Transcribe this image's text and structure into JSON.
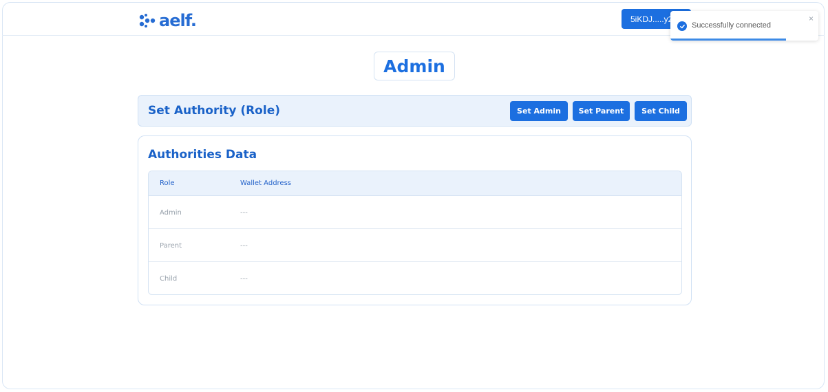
{
  "header": {
    "logo_text": "aelf.",
    "wallet_label": "5iKDJ.....y2"
  },
  "toast": {
    "message": "Successfully connected",
    "close_glyph": "×",
    "progress": 0.78
  },
  "main": {
    "title": "Admin",
    "authority": {
      "title": "Set Authority (Role)",
      "buttons": [
        "Set Admin",
        "Set Parent",
        "Set Child"
      ]
    },
    "data": {
      "title": "Authorities Data",
      "columns": [
        "Role",
        "Wallet Address"
      ],
      "rows": [
        {
          "role": "Admin",
          "address": "---"
        },
        {
          "role": "Parent",
          "address": "---"
        },
        {
          "role": "Child",
          "address": "---"
        }
      ]
    }
  },
  "colors": {
    "primary": "#1C6FE0",
    "heading": "#1a62c8",
    "panel_bg": "#eaf2fc"
  },
  "icons": {
    "logo": "aelf-dots-icon",
    "toast_status": "check-circle-icon",
    "toast_close": "close-icon"
  }
}
